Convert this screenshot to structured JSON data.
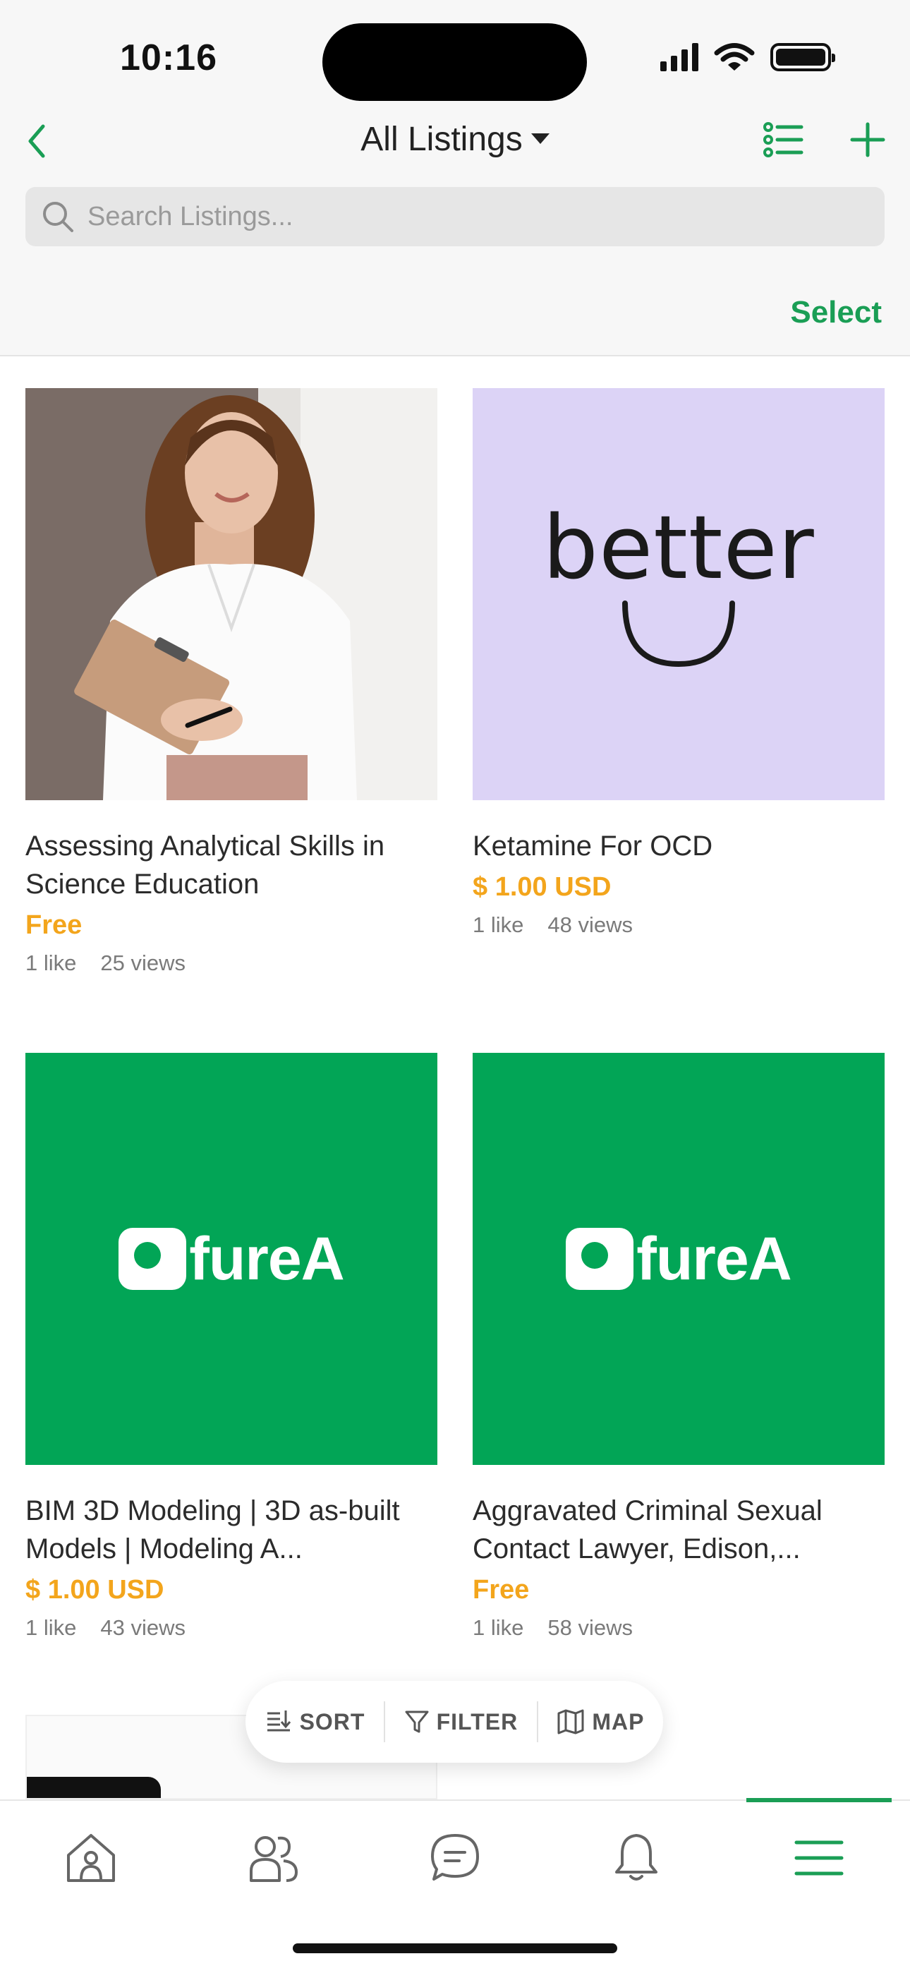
{
  "status_bar": {
    "time": "10:16"
  },
  "nav": {
    "title": "All Listings",
    "search_placeholder": "Search Listings...",
    "select_label": "Select"
  },
  "colors": {
    "accent": "#1a9e55",
    "price": "#f3a51c",
    "ofurea_green": "#02a556",
    "better_purple": "#dcd3f6"
  },
  "listings": [
    {
      "title": "Assessing Analytical Skills in Science Education",
      "price": "Free",
      "likes": "1 like",
      "views": "25 views",
      "image": "woman-with-clipboard-photo"
    },
    {
      "title": "Ketamine For OCD",
      "price": "$ 1.00 USD",
      "likes": "1 like",
      "views": "48 views",
      "image": "better-logo",
      "logo_text": "better"
    },
    {
      "title": "BIM 3D Modeling | 3D as-built Models | Modeling A...",
      "price": "$ 1.00 USD",
      "likes": "1 like",
      "views": "43 views",
      "image": "ofurea-logo",
      "logo_text": "fureA"
    },
    {
      "title": "Aggravated Criminal Sexual Contact Lawyer, Edison,...",
      "price": "Free",
      "likes": "1 like",
      "views": "58 views",
      "image": "ofurea-logo",
      "logo_text": "fureA"
    }
  ],
  "actions": {
    "sort": "SORT",
    "filter": "FILTER",
    "map": "MAP"
  },
  "tabs": [
    {
      "name": "home",
      "icon": "home-icon"
    },
    {
      "name": "groups",
      "icon": "people-icon"
    },
    {
      "name": "messages",
      "icon": "chat-icon"
    },
    {
      "name": "notifications",
      "icon": "bell-icon"
    },
    {
      "name": "menu",
      "icon": "menu-icon",
      "active": true
    }
  ]
}
